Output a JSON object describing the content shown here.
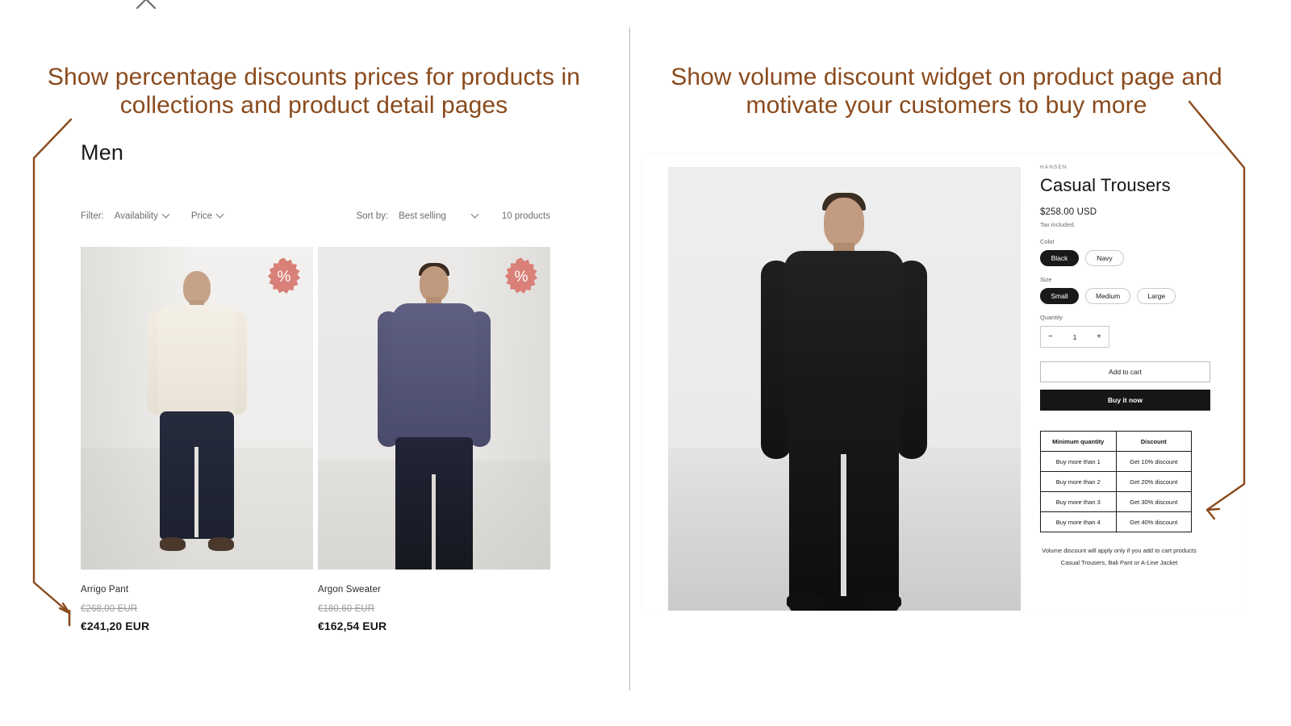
{
  "headings": {
    "left": "Show percentage discounts prices for products in collections and product detail pages",
    "right": "Show volume discount widget on product page and motivate your customers to buy more"
  },
  "colors": {
    "annotation": "#8a4a1c",
    "badge": "#d98078",
    "accent_dark": "#161616",
    "muted_text": "#6e6e6e"
  },
  "collection": {
    "title": "Men",
    "filter_label": "Filter:",
    "filters": [
      {
        "label": "Availability",
        "icon": "chevron-down-icon"
      },
      {
        "label": "Price",
        "icon": "chevron-down-icon"
      }
    ],
    "sort_label": "Sort by:",
    "sort_value": "Best selling",
    "product_count": "10 products",
    "products": [
      {
        "title": "Arrigo Pant",
        "price_compare": "€268,00 EUR",
        "price_sale": "€241,20 EUR",
        "badge": "%"
      },
      {
        "title": "Argon Sweater",
        "price_compare": "€180,60 EUR",
        "price_sale": "€162,54 EUR",
        "badge": "%"
      }
    ]
  },
  "product_page": {
    "vendor": "HANSEN",
    "title": "Casual Trousers",
    "price": "$258.00 USD",
    "tax_note": "Tax included.",
    "options": [
      {
        "label": "Color",
        "values": [
          {
            "label": "Black",
            "selected": true
          },
          {
            "label": "Navy",
            "selected": false
          }
        ]
      },
      {
        "label": "Size",
        "values": [
          {
            "label": "Small",
            "selected": true
          },
          {
            "label": "Medium",
            "selected": false
          },
          {
            "label": "Large",
            "selected": false
          }
        ]
      }
    ],
    "quantity": {
      "label": "Quantity",
      "value": "1",
      "decrease": "−",
      "increase": "+"
    },
    "add_to_cart": "Add to cart",
    "buy_it_now": "Buy it now",
    "volume_discount": {
      "headers": [
        "Minimum quantity",
        "Discount"
      ],
      "rows": [
        [
          "Buy more than 1",
          "Get 10% discount"
        ],
        [
          "Buy more than 2",
          "Get 20% discount"
        ],
        [
          "Buy more than 3",
          "Get 30% discount"
        ],
        [
          "Buy more than 4",
          "Get 40% discount"
        ]
      ],
      "note": "Volume discount will apply only if you add to cart products Casual Trousers, Bali Pant or A-Line Jacket"
    }
  }
}
